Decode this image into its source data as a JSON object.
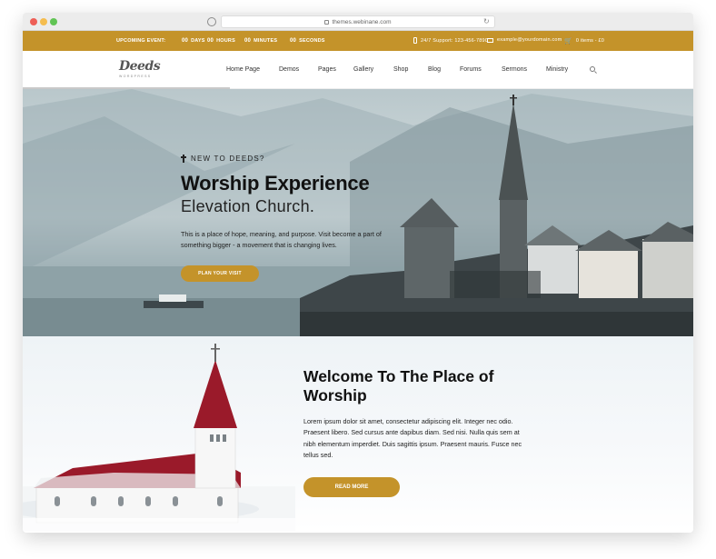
{
  "browser": {
    "url": "themes.webinane.com"
  },
  "topbar": {
    "event_label": "UPCOMING EVENT:",
    "countdown": [
      {
        "value": "00",
        "unit": "DAYS"
      },
      {
        "value": "00",
        "unit": "HOURS"
      },
      {
        "value": "00",
        "unit": "MINUTES"
      },
      {
        "value": "00",
        "unit": "SECONDS"
      }
    ],
    "phone": "24/7 Support: 123-456-7890",
    "email": "example@yourdomain.com",
    "cart": "0 items - £0"
  },
  "logo": {
    "name": "Deeds",
    "tagline": "WORDPRESS"
  },
  "nav": {
    "items": [
      "Home Page",
      "Demos",
      "Pages",
      "Gallery",
      "Shop",
      "Blog",
      "Forums",
      "Sermons",
      "Ministry"
    ]
  },
  "hero": {
    "kicker": "NEW TO DEEDS?",
    "title": "Worship Experience",
    "subtitle": "Elevation Church.",
    "description": "This is a place of hope, meaning, and purpose. Visit become a part of something bigger - a movement that is changing lives.",
    "button": "PLAN YOUR VISIT"
  },
  "welcome": {
    "title": "Welcome To The Place of Worship",
    "description": "Lorem ipsum dolor sit amet, consectetur adipiscing elit. Integer nec odio. Praesent libero. Sed cursus ante dapibus diam. Sed nisi. Nulla quis sem at nibh elementum imperdiet. Duis sagittis ipsum. Praesent mauris. Fusce nec tellus sed.",
    "button": "READ MORE"
  },
  "colors": {
    "accent": "#c4932a",
    "church_roof": "#9a1a2a"
  }
}
